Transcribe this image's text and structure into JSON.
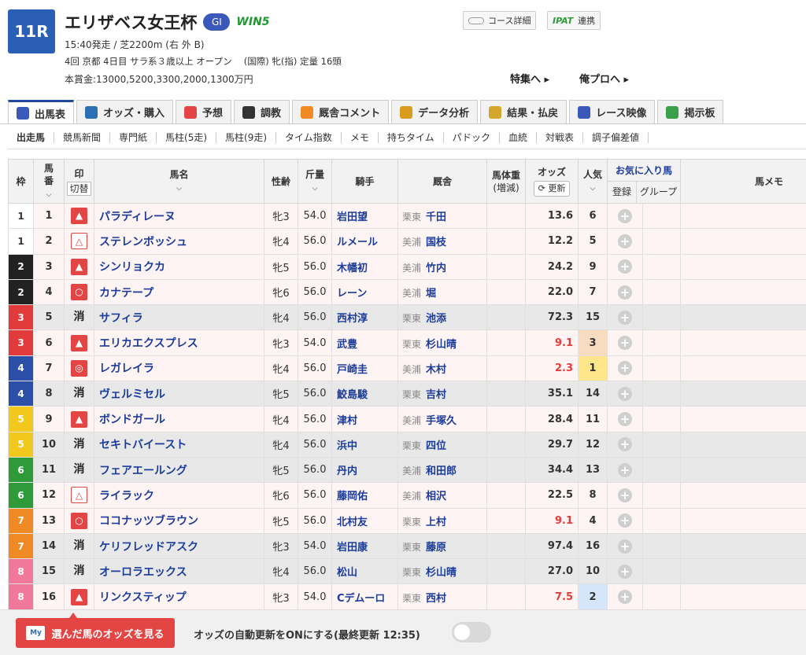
{
  "race": {
    "number": "11R",
    "title": "エリザベス女王杯",
    "grade": "GI",
    "win5": "WIN5",
    "line1": "15:40発走 / 芝2200m (右 外 B)",
    "line2": "4回 京都 4日目 サラ系３歳以上 オープン　 (国際) 牝(指) 定量 16頭",
    "line3": "本賞金:13000,5200,3300,2000,1300万円"
  },
  "top_buttons": {
    "course": "コース詳細",
    "ipat": "IPAT",
    "renkei": "連携"
  },
  "top_links": {
    "feature": "特集へ ▸",
    "orepro": "俺プロへ ▸"
  },
  "tabs": [
    {
      "label": "出馬表",
      "icon": "table-icon",
      "color": "#3a59b8"
    },
    {
      "label": "オッズ・購入",
      "icon": "odds-icon",
      "color": "#2b6fb5"
    },
    {
      "label": "予想",
      "icon": "target-icon",
      "color": "#e34545"
    },
    {
      "label": "調教",
      "icon": "stopwatch-icon",
      "color": "#333333"
    },
    {
      "label": "厩舎コメント",
      "icon": "person-icon",
      "color": "#f08a24"
    },
    {
      "label": "データ分析",
      "icon": "bar-chart-icon",
      "color": "#d89b1e"
    },
    {
      "label": "結果・払戻",
      "icon": "coins-icon",
      "color": "#d4a72c"
    },
    {
      "label": "レース映像",
      "icon": "video-icon",
      "color": "#3a59b8"
    },
    {
      "label": "掲示板",
      "icon": "chat-icon",
      "color": "#3aa04a"
    }
  ],
  "subtabs": [
    "出走馬",
    "競馬新聞",
    "専門紙",
    "馬柱(5走)",
    "馬柱(9走)",
    "タイム指数",
    "メモ",
    "持ちタイム",
    "パドック",
    "血統",
    "対戦表",
    "調子偏差値"
  ],
  "headers": {
    "waku": "枠",
    "umaban": "馬\n番",
    "mark": "印",
    "mark_switch": "切替",
    "name": "馬名",
    "age": "性齢",
    "weight": "斤量",
    "jockey": "騎手",
    "stable": "厩舎",
    "body": "馬体重",
    "body2": "(増減)",
    "odds": "オッズ",
    "refresh": "更新",
    "pop": "人気",
    "fav": "お気に入り馬",
    "reg": "登録",
    "group": "グループ",
    "memo": "馬メモ"
  },
  "waku_colors": {
    "1": "#ffffff",
    "2": "#222222",
    "3": "#e23b3b",
    "4": "#2b4fa8",
    "5": "#f2c81e",
    "6": "#2f9a3a",
    "7": "#f08a24",
    "8": "#f0799b"
  },
  "horses": [
    {
      "waku": "1",
      "num": "1",
      "mark": "▲",
      "mtype": "tri",
      "name": "パラディレーヌ",
      "age": "牝3",
      "wt": "54.0",
      "jockey": "岩田望",
      "region": "栗東",
      "trainer": "千田",
      "odds": "13.6",
      "pop": "6",
      "row": "pink"
    },
    {
      "waku": "1",
      "num": "2",
      "mark": "△",
      "mtype": "otri",
      "name": "ステレンボッシュ",
      "age": "牝4",
      "wt": "56.0",
      "jockey": "ルメール",
      "region": "美浦",
      "trainer": "国枝",
      "odds": "12.2",
      "pop": "5",
      "row": "pink"
    },
    {
      "waku": "2",
      "num": "3",
      "mark": "▲",
      "mtype": "tri",
      "name": "シンリョクカ",
      "age": "牝5",
      "wt": "56.0",
      "jockey": "木幡初",
      "region": "美浦",
      "trainer": "竹内",
      "odds": "24.2",
      "pop": "9",
      "row": "pink"
    },
    {
      "waku": "2",
      "num": "4",
      "mark": "○",
      "mtype": "circ",
      "name": "カナテープ",
      "age": "牝6",
      "wt": "56.0",
      "jockey": "レーン",
      "region": "美浦",
      "trainer": "堀",
      "odds": "22.0",
      "pop": "7",
      "row": "pink"
    },
    {
      "waku": "3",
      "num": "5",
      "mark": "消",
      "mtype": "kesu",
      "name": "サフィラ",
      "age": "牝4",
      "wt": "56.0",
      "jockey": "西村淳",
      "region": "栗東",
      "trainer": "池添",
      "odds": "72.3",
      "pop": "15",
      "row": "gray"
    },
    {
      "waku": "3",
      "num": "6",
      "mark": "▲",
      "mtype": "tri",
      "name": "エリカエクスプレス",
      "age": "牝3",
      "wt": "54.0",
      "jockey": "武豊",
      "region": "栗東",
      "trainer": "杉山晴",
      "odds": "9.1",
      "pop": "3",
      "row": "pink",
      "low": true,
      "popbg": "#f8dcc0"
    },
    {
      "waku": "4",
      "num": "7",
      "mark": "◎",
      "mtype": "dbl",
      "name": "レガレイラ",
      "age": "牝4",
      "wt": "56.0",
      "jockey": "戸崎圭",
      "region": "美浦",
      "trainer": "木村",
      "odds": "2.3",
      "pop": "1",
      "row": "pink",
      "low": true,
      "popbg": "#ffe68a"
    },
    {
      "waku": "4",
      "num": "8",
      "mark": "消",
      "mtype": "kesu",
      "name": "ヴェルミセル",
      "age": "牝5",
      "wt": "56.0",
      "jockey": "鮫島駿",
      "region": "栗東",
      "trainer": "吉村",
      "odds": "35.1",
      "pop": "14",
      "row": "gray"
    },
    {
      "waku": "5",
      "num": "9",
      "mark": "▲",
      "mtype": "tri",
      "name": "ボンドガール",
      "age": "牝4",
      "wt": "56.0",
      "jockey": "津村",
      "region": "美浦",
      "trainer": "手塚久",
      "odds": "28.4",
      "pop": "11",
      "row": "pink"
    },
    {
      "waku": "5",
      "num": "10",
      "mark": "消",
      "mtype": "kesu",
      "name": "セキトバイースト",
      "age": "牝4",
      "wt": "56.0",
      "jockey": "浜中",
      "region": "栗東",
      "trainer": "四位",
      "odds": "29.7",
      "pop": "12",
      "row": "gray"
    },
    {
      "waku": "6",
      "num": "11",
      "mark": "消",
      "mtype": "kesu",
      "name": "フェアエールング",
      "age": "牝5",
      "wt": "56.0",
      "jockey": "丹内",
      "region": "美浦",
      "trainer": "和田郎",
      "odds": "34.4",
      "pop": "13",
      "row": "gray"
    },
    {
      "waku": "6",
      "num": "12",
      "mark": "△",
      "mtype": "otri",
      "name": "ライラック",
      "age": "牝6",
      "wt": "56.0",
      "jockey": "藤岡佑",
      "region": "美浦",
      "trainer": "相沢",
      "odds": "22.5",
      "pop": "8",
      "row": "pink"
    },
    {
      "waku": "7",
      "num": "13",
      "mark": "○",
      "mtype": "circ",
      "name": "ココナッツブラウン",
      "age": "牝5",
      "wt": "56.0",
      "jockey": "北村友",
      "region": "栗東",
      "trainer": "上村",
      "odds": "9.1",
      "pop": "4",
      "row": "pink",
      "low": true
    },
    {
      "waku": "7",
      "num": "14",
      "mark": "消",
      "mtype": "kesu",
      "name": "ケリフレッドアスク",
      "age": "牝3",
      "wt": "54.0",
      "jockey": "岩田康",
      "region": "栗東",
      "trainer": "藤原",
      "odds": "97.4",
      "pop": "16",
      "row": "gray"
    },
    {
      "waku": "8",
      "num": "15",
      "mark": "消",
      "mtype": "kesu",
      "name": "オーロラエックス",
      "age": "牝4",
      "wt": "56.0",
      "jockey": "松山",
      "region": "栗東",
      "trainer": "杉山晴",
      "odds": "27.0",
      "pop": "10",
      "row": "gray"
    },
    {
      "waku": "8",
      "num": "16",
      "mark": "▲",
      "mtype": "tri",
      "name": "リンクスティップ",
      "age": "牝3",
      "wt": "54.0",
      "jockey": "Cデムーロ",
      "region": "栗東",
      "trainer": "西村",
      "odds": "7.5",
      "pop": "2",
      "row": "pink",
      "low": true,
      "popbg": "#d5e6fb"
    }
  ],
  "bottom": {
    "odds_button": "選んだ馬のオッズを見る",
    "auto_update": "オッズの自動更新をONにする(最終更新 12:35)"
  }
}
